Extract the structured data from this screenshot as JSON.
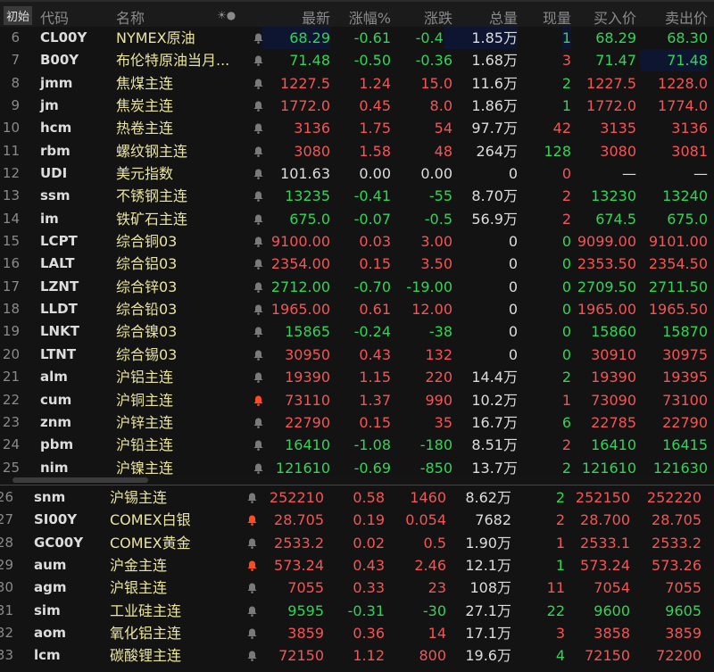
{
  "header": {
    "init": "初始",
    "code": "代码",
    "name": "名称",
    "icons": "☀●",
    "last": "最新",
    "pct": "涨幅%",
    "chg": "涨跌",
    "vol": "总量",
    "cur": "现量",
    "bid": "买入价",
    "ask": "卖出价"
  },
  "colors": {
    "up": "#f25656",
    "down": "#36d25a",
    "name": "#ebe4a0",
    "bell_active": "#ff4b1f"
  },
  "top_rows": [
    {
      "n": "6",
      "code": "CL00Y",
      "name": "NYMEX原油",
      "last": "68.29",
      "pct": "-0.61",
      "chg": "-0.42",
      "vol": "1.85万",
      "cur": "1",
      "bid": "68.29",
      "ask": "68.30",
      "d": "down",
      "cd": "down",
      "bell": false
    },
    {
      "n": "7",
      "code": "B00Y",
      "name": "布伦特原油当月...",
      "last": "71.48",
      "pct": "-0.50",
      "chg": "-0.36",
      "vol": "1.68万",
      "cur": "3",
      "bid": "71.47",
      "ask": "71.48",
      "d": "down",
      "cd": "up",
      "bell": false
    },
    {
      "n": "8",
      "code": "jmm",
      "name": "焦煤主连",
      "last": "1227.5",
      "pct": "1.24",
      "chg": "15.0",
      "vol": "11.6万",
      "cur": "2",
      "bid": "1227.5",
      "ask": "1228.0",
      "d": "up",
      "cd": "down",
      "bell": false
    },
    {
      "n": "9",
      "code": "jm",
      "name": "焦炭主连",
      "last": "1772.0",
      "pct": "0.45",
      "chg": "8.0",
      "vol": "1.86万",
      "cur": "1",
      "bid": "1772.0",
      "ask": "1774.0",
      "d": "up",
      "cd": "down",
      "bell": false
    },
    {
      "n": "10",
      "code": "hcm",
      "name": "热卷主连",
      "last": "3136",
      "pct": "1.75",
      "chg": "54",
      "vol": "97.7万",
      "cur": "42",
      "bid": "3135",
      "ask": "3136",
      "d": "up",
      "cd": "up",
      "bell": false
    },
    {
      "n": "11",
      "code": "rbm",
      "name": "螺纹钢主连",
      "last": "3080",
      "pct": "1.58",
      "chg": "48",
      "vol": "264万",
      "cur": "128",
      "bid": "3080",
      "ask": "3081",
      "d": "up",
      "cd": "down",
      "bell": false
    },
    {
      "n": "12",
      "code": "UDI",
      "name": "美元指数",
      "last": "101.63",
      "pct": "0.00",
      "chg": "0.00",
      "vol": "0",
      "cur": "0",
      "bid": "—",
      "ask": "—",
      "d": "flat",
      "cd": "up",
      "bell": false
    },
    {
      "n": "13",
      "code": "ssm",
      "name": "不锈钢主连",
      "last": "13235",
      "pct": "-0.41",
      "chg": "-55",
      "vol": "8.70万",
      "cur": "2",
      "bid": "13230",
      "ask": "13240",
      "d": "down",
      "cd": "up",
      "bell": false
    },
    {
      "n": "14",
      "code": "im",
      "name": "铁矿石主连",
      "last": "675.0",
      "pct": "-0.07",
      "chg": "-0.5",
      "vol": "56.9万",
      "cur": "2",
      "bid": "674.5",
      "ask": "675.0",
      "d": "down",
      "cd": "up",
      "bell": false
    },
    {
      "n": "15",
      "code": "LCPT",
      "name": "综合铜03",
      "last": "9100.00",
      "pct": "0.03",
      "chg": "3.00",
      "vol": "0",
      "cur": "0",
      "bid": "9099.00",
      "ask": "9101.00",
      "d": "up",
      "cd": "down",
      "bell": false
    },
    {
      "n": "16",
      "code": "LALT",
      "name": "综合铝03",
      "last": "2354.00",
      "pct": "0.15",
      "chg": "3.50",
      "vol": "0",
      "cur": "0",
      "bid": "2353.50",
      "ask": "2354.50",
      "d": "up",
      "cd": "down",
      "bell": false
    },
    {
      "n": "17",
      "code": "LZNT",
      "name": "综合锌03",
      "last": "2712.00",
      "pct": "-0.70",
      "chg": "-19.00",
      "vol": "0",
      "cur": "0",
      "bid": "2709.50",
      "ask": "2711.50",
      "d": "down",
      "cd": "down",
      "bell": false
    },
    {
      "n": "18",
      "code": "LLDT",
      "name": "综合铅03",
      "last": "1965.00",
      "pct": "0.61",
      "chg": "12.00",
      "vol": "0",
      "cur": "0",
      "bid": "1965.00",
      "ask": "1965.50",
      "d": "up",
      "cd": "down",
      "bell": false
    },
    {
      "n": "19",
      "code": "LNKT",
      "name": "综合镍03",
      "last": "15865",
      "pct": "-0.24",
      "chg": "-38",
      "vol": "0",
      "cur": "0",
      "bid": "15860",
      "ask": "15870",
      "d": "down",
      "cd": "down",
      "bell": false
    },
    {
      "n": "20",
      "code": "LTNT",
      "name": "综合锡03",
      "last": "30950",
      "pct": "0.43",
      "chg": "132",
      "vol": "0",
      "cur": "0",
      "bid": "30910",
      "ask": "30975",
      "d": "up",
      "cd": "down",
      "bell": false
    },
    {
      "n": "21",
      "code": "alm",
      "name": "沪铝主连",
      "last": "19390",
      "pct": "1.15",
      "chg": "220",
      "vol": "14.4万",
      "cur": "2",
      "bid": "19390",
      "ask": "19395",
      "d": "up",
      "cd": "down",
      "bell": false
    },
    {
      "n": "22",
      "code": "cum",
      "name": "沪铜主连",
      "last": "73110",
      "pct": "1.37",
      "chg": "990",
      "vol": "10.2万",
      "cur": "1",
      "bid": "73090",
      "ask": "73100",
      "d": "up",
      "cd": "up",
      "bell": true
    },
    {
      "n": "23",
      "code": "znm",
      "name": "沪锌主连",
      "last": "22790",
      "pct": "0.15",
      "chg": "35",
      "vol": "16.7万",
      "cur": "6",
      "bid": "22785",
      "ask": "22790",
      "d": "up",
      "cd": "down",
      "bell": false
    },
    {
      "n": "24",
      "code": "pbm",
      "name": "沪铅主连",
      "last": "16410",
      "pct": "-1.08",
      "chg": "-180",
      "vol": "8.51万",
      "cur": "2",
      "bid": "16410",
      "ask": "16415",
      "d": "down",
      "cd": "up",
      "bell": false
    },
    {
      "n": "25",
      "code": "nim",
      "name": "沪镍主连",
      "last": "121610",
      "pct": "-0.69",
      "chg": "-850",
      "vol": "13.7万",
      "cur": "2",
      "bid": "121610",
      "ask": "121630",
      "d": "down",
      "cd": "down",
      "bell": false
    }
  ],
  "bottom_rows": [
    {
      "n": "26",
      "code": "snm",
      "name": "沪锡主连",
      "last": "252210",
      "pct": "0.58",
      "chg": "1460",
      "vol": "8.62万",
      "cur": "2",
      "bid": "252150",
      "ask": "252220",
      "d": "up",
      "cd": "down",
      "bell": false
    },
    {
      "n": "27",
      "code": "SI00Y",
      "name": "COMEX白银",
      "last": "28.705",
      "pct": "0.19",
      "chg": "0.054",
      "vol": "7682",
      "cur": "2",
      "bid": "28.700",
      "ask": "28.705",
      "d": "up",
      "cd": "up",
      "bell": true
    },
    {
      "n": "28",
      "code": "GC00Y",
      "name": "COMEX黄金",
      "last": "2533.2",
      "pct": "0.02",
      "chg": "0.5",
      "vol": "1.90万",
      "cur": "1",
      "bid": "2533.1",
      "ask": "2533.2",
      "d": "up",
      "cd": "up",
      "bell": false
    },
    {
      "n": "29",
      "code": "aum",
      "name": "沪金主连",
      "last": "573.24",
      "pct": "0.43",
      "chg": "2.46",
      "vol": "12.1万",
      "cur": "1",
      "bid": "573.24",
      "ask": "573.26",
      "d": "up",
      "cd": "down",
      "bell": true
    },
    {
      "n": "30",
      "code": "agm",
      "name": "沪银主连",
      "last": "7055",
      "pct": "0.33",
      "chg": "23",
      "vol": "108万",
      "cur": "11",
      "bid": "7054",
      "ask": "7055",
      "d": "up",
      "cd": "up",
      "bell": false
    },
    {
      "n": "31",
      "code": "sim",
      "name": "工业硅主连",
      "last": "9595",
      "pct": "-0.31",
      "chg": "-30",
      "vol": "27.1万",
      "cur": "22",
      "bid": "9600",
      "ask": "9605",
      "d": "down",
      "cd": "down",
      "bell": false
    },
    {
      "n": "32",
      "code": "aom",
      "name": "氧化铝主连",
      "last": "3859",
      "pct": "0.36",
      "chg": "14",
      "vol": "17.1万",
      "cur": "3",
      "bid": "3858",
      "ask": "3859",
      "d": "up",
      "cd": "up",
      "bell": false
    },
    {
      "n": "33",
      "code": "lcm",
      "name": "碳酸锂主连",
      "last": "72150",
      "pct": "1.12",
      "chg": "800",
      "vol": "19.6万",
      "cur": "4",
      "bid": "72150",
      "ask": "72200",
      "d": "up",
      "cd": "down",
      "bell": false
    }
  ]
}
